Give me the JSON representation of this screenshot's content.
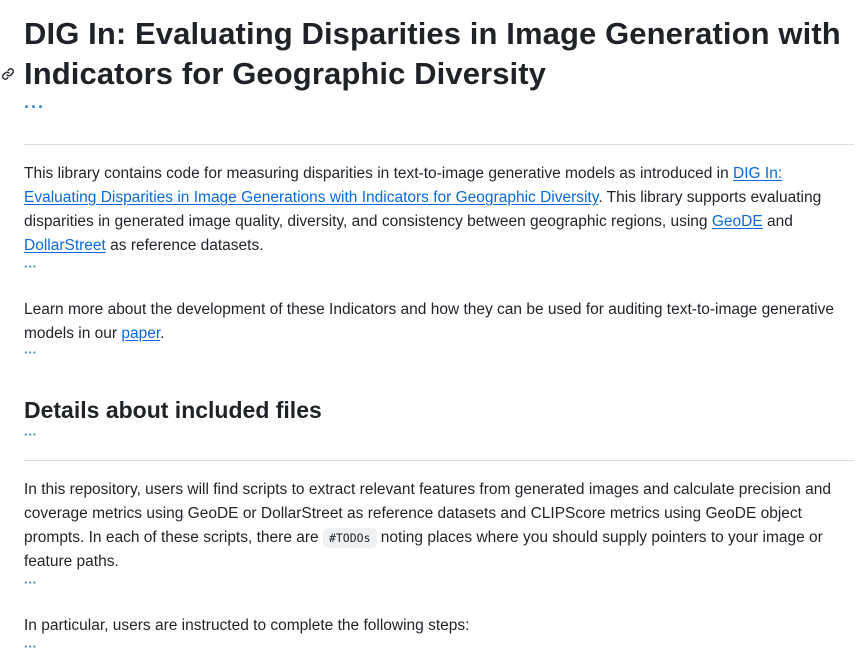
{
  "heading": {
    "title": "DIG In: Evaluating Disparities in Image Generation with Indicators for Geographic Diversity",
    "anchor_icon": "link-icon",
    "more_label": "···"
  },
  "intro": {
    "part1": "This library contains code for measuring disparities in text-to-image generative models as introduced in ",
    "paper_link": "DIG In: Evaluating Disparities in Image Generations with Indicators for Geographic Diversity",
    "part2": ". This library supports evaluating disparities in generated image quality, diversity, and consistency between geographic regions, using ",
    "geode_link": "GeoDE",
    "part3": " and ",
    "dollarstreet_link": "DollarStreet",
    "part4": " as reference datasets.",
    "more_label": "···"
  },
  "learn_more": {
    "part1": "Learn more about the development of these Indicators and how they can be used for auditing text-to-image generative models in our ",
    "paper_link": "paper",
    "part2": ".",
    "more_label": "···"
  },
  "details": {
    "title": "Details about included files",
    "more_label": "···"
  },
  "repo_para": {
    "part1": "In this repository, users will find scripts to extract relevant features from generated images and calculate precision and coverage metrics using GeoDE or DollarStreet as reference datasets and CLIPScore metrics using GeoDE object prompts. In each of these scripts, there are ",
    "code": "#TODOs",
    "part2": " noting places where you should supply pointers to your image or feature paths.",
    "more_label": "···"
  },
  "steps_para": {
    "text": "In particular, users are instructed to complete the following steps:",
    "more_label": "···"
  },
  "colors": {
    "link": "#0969da",
    "ellipsis": "#3d86c6",
    "text": "#1f2328",
    "rule": "#d8dee4",
    "code_bg": "#eff1f3"
  }
}
